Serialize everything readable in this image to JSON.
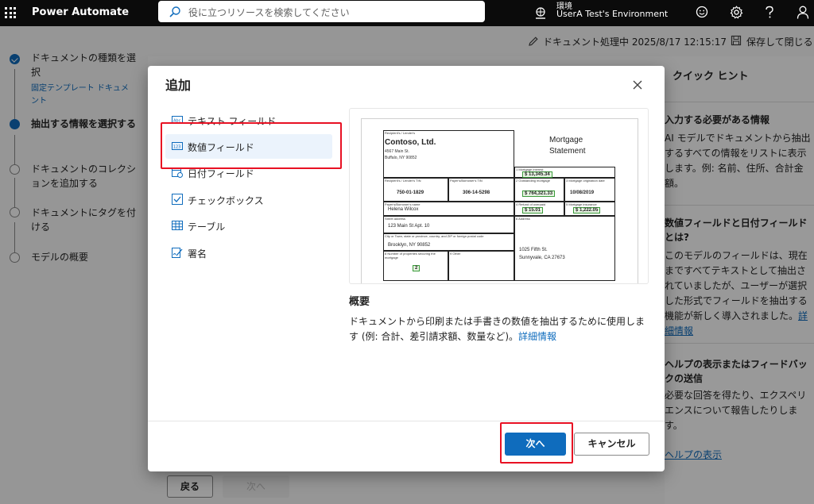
{
  "app": {
    "brand": "Power Automate"
  },
  "search": {
    "placeholder": "役に立つリソースを検索してください"
  },
  "environment": {
    "label": "環境",
    "name": "UserA Test's Environment"
  },
  "savebar": {
    "status": "ドキュメント処理中 2025/8/17 12:15:17",
    "save_label": "保存して閉じる"
  },
  "steps": [
    {
      "label": "ドキュメントの種類を選択",
      "sub": "固定テンプレート ドキュメント",
      "state": "done"
    },
    {
      "label": "抽出する情報を選択する",
      "state": "current"
    },
    {
      "label": "ドキュメントのコレクションを追加する",
      "state": "todo"
    },
    {
      "label": "ドキュメントにタグを付ける",
      "state": "todo"
    },
    {
      "label": "モデルの概要",
      "state": "todo"
    }
  ],
  "bottom": {
    "back": "戻る",
    "next": "次へ"
  },
  "hints": {
    "title": "クイック ヒント",
    "cards": [
      {
        "title": "入力する必要がある情報",
        "body": "AI モデルでドキュメントから抽出するすべての情報をリストに表示します。例: 名前、住所、合計金額。"
      },
      {
        "title": "数値フィールドと日付フィールドとは?",
        "body": "このモデルのフィールドは、現在まですべてテキストとして抽出されていましたが、ユーザーが選択した形式でフィールドを抽出する機能が新しく導入されました。",
        "link": "詳細情報"
      },
      {
        "title": "ヘルプの表示またはフィードバックの送信",
        "body": "必要な回答を得たり、エクスペリエンスについて報告したりします。"
      }
    ],
    "help_link": "ヘルプの表示"
  },
  "modal": {
    "title": "追加",
    "options": [
      {
        "label": "テキスト フィールド",
        "icon": "text-field-icon"
      },
      {
        "label": "数値フィールド",
        "icon": "number-field-icon",
        "selected": true
      },
      {
        "label": "日付フィールド",
        "icon": "date-field-icon"
      },
      {
        "label": "チェックボックス",
        "icon": "checkbox-icon"
      },
      {
        "label": "テーブル",
        "icon": "table-icon"
      },
      {
        "label": "署名",
        "icon": "signature-icon"
      }
    ],
    "preview": {
      "recipient_label": "Recipient's / Lender's",
      "company": "Contoso, Ltd.",
      "addr1": "4567 Main St.",
      "addr2": "Buffalo, NY 90852",
      "doc_title_1": "Mortgage",
      "doc_title_2": "Statement",
      "mortgage_interest_label": "1 Mortgage interest",
      "mortgage_interest": "13,345.34",
      "tin_label": "Recipient's / Lender's TIN",
      "tin": "750-01-1829",
      "borrower_tin_label": "Payer's/Borrower's TIN",
      "borrower_tin": "306-14-5298",
      "outstanding_label": "2 Outstanding mortgage",
      "outstanding": "764,321.33",
      "origination_label": "3 Mortgage origination date",
      "origination": "10/08/2019",
      "borrower_name_label": "Payer's/Borrower's name",
      "borrower_name": "Helena Wilcox",
      "refund_label": "4 Refund of overpaid",
      "refund": "15.01",
      "insurance_label": "5 Mortgage insurance",
      "insurance": "1,222.05",
      "street_label": "Street address",
      "street": "123 Main St Apt. 10",
      "address_label": "6 Address",
      "city_label": "City or Town, state or province, country, and ZIP or foreign postal code",
      "city": "Brooklyn, NY 90852",
      "prop_label": "8 Number of properties securing the mortgage",
      "prop": "2",
      "other_label": "9 Other",
      "prop_addr1": "1025 Fifth St.",
      "prop_addr2": "Sunnyvale, CA 27673"
    },
    "summary_title": "概要",
    "summary_body": "ドキュメントから印刷または手書きの数値を抽出するために使用します (例: 合計、差引請求額、数量など)。",
    "summary_link": "詳細情報",
    "primary": "次へ",
    "secondary": "キャンセル"
  }
}
